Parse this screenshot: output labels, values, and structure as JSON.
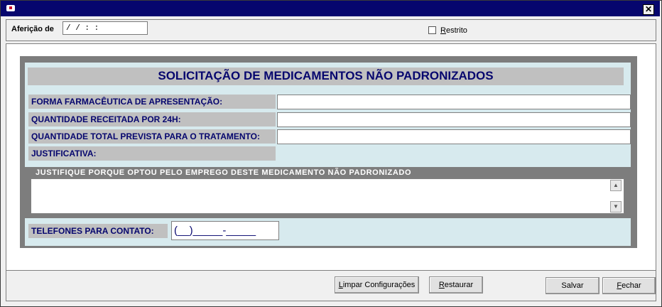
{
  "window": {
    "close_glyph": "✕"
  },
  "header": {
    "afericao_label": "Aferição de",
    "afericao_value": " / /      : :",
    "restrito_label": "Restrito",
    "restrito_checked": false
  },
  "form": {
    "title": "SOLICITAÇÃO DE MEDICAMENTOS NÃO PADRONIZADOS",
    "fields": [
      {
        "label": "FORMA FARMACÊUTICA DE APRESENTAÇÃO:",
        "value": ""
      },
      {
        "label": "QUANTIDADE RECEITADA POR 24H:",
        "value": ""
      },
      {
        "label": "QUANTIDADE TOTAL PREVISTA PARA O TRATAMENTO:",
        "value": ""
      },
      {
        "label": "JUSTIFICATIVA:"
      }
    ],
    "justification_caption": "JUSTIFIQUE PORQUE OPTOU PELO EMPREGO DESTE MEDICAMENTO NÃO PADRONIZADO",
    "justification_value": "",
    "phone_label": "TELEFONES PARA CONTATO:",
    "phone_value": "(__)_____-_____"
  },
  "footer": {
    "limpar_label_u": "L",
    "limpar_label_rest": "impar Configurações",
    "restaurar_label_u": "R",
    "restaurar_label_rest": "estaurar",
    "salvar_label": "Salvar",
    "fechar_label_u": "F",
    "fechar_label_rest": "echar"
  },
  "colors": {
    "titlebar": "#06066e",
    "label_text": "#06066e",
    "panel_bg": "#d7eaee",
    "label_bg": "#c0c0c0",
    "frame": "#7d7d7d"
  },
  "icons": [
    "app-icon",
    "close-icon",
    "checkbox-icon",
    "scroll-up-icon",
    "scroll-down-icon"
  ]
}
